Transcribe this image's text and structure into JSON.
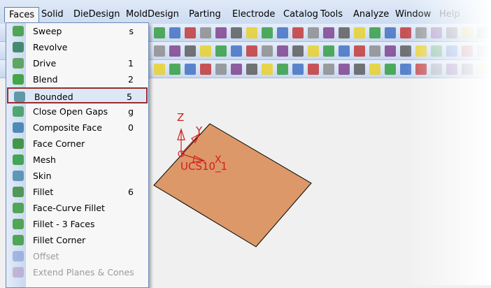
{
  "menubar": [
    "Faces",
    "Solid",
    "DieDesign",
    "MoldDesign",
    "Parting",
    "Electrode",
    "Catalog",
    "Tools",
    "Analyze",
    "Window",
    "Help"
  ],
  "faces_menu": [
    {
      "label": "Sweep",
      "key": "s",
      "icon": "sweep-icon"
    },
    {
      "label": "Revolve",
      "key": "",
      "icon": "revolve-icon"
    },
    {
      "label": "Drive",
      "key": "1",
      "icon": "drive-icon"
    },
    {
      "label": "Blend",
      "key": "2",
      "icon": "blend-icon"
    },
    {
      "label": "Bounded",
      "key": "5",
      "icon": "bounded-icon",
      "selected": true
    },
    {
      "label": "Close Open Gaps",
      "key": "g",
      "icon": "close-gaps-icon"
    },
    {
      "label": "Composite Face",
      "key": "0",
      "icon": "composite-face-icon"
    },
    {
      "label": "Face Corner",
      "key": "",
      "icon": "face-corner-icon"
    },
    {
      "label": "Mesh",
      "key": "",
      "icon": "mesh-icon"
    },
    {
      "label": "Skin",
      "key": "",
      "icon": "skin-icon"
    },
    {
      "label": "Fillet",
      "key": "6",
      "icon": "fillet-icon"
    },
    {
      "label": "Face-Curve Fillet",
      "key": "",
      "icon": "face-curve-fillet-icon"
    },
    {
      "label": "Fillet - 3 Faces",
      "key": "",
      "icon": "fillet-3-faces-icon"
    },
    {
      "label": "Fillet Corner",
      "key": "",
      "icon": "fillet-corner-icon"
    },
    {
      "label": "Offset",
      "key": "",
      "icon": "offset-icon",
      "disabled": true
    },
    {
      "label": "Extend Planes & Cones",
      "key": "",
      "icon": "extend-planes-icon",
      "disabled": true
    }
  ],
  "viewport": {
    "axis_z": "Z",
    "axis_y": "Y",
    "axis_x": "X",
    "ucs_label": "UCS10_1"
  },
  "colors": {
    "face": "#dc9868",
    "ucs": "#d02020",
    "menu_highlight": "#9b2c2c"
  }
}
